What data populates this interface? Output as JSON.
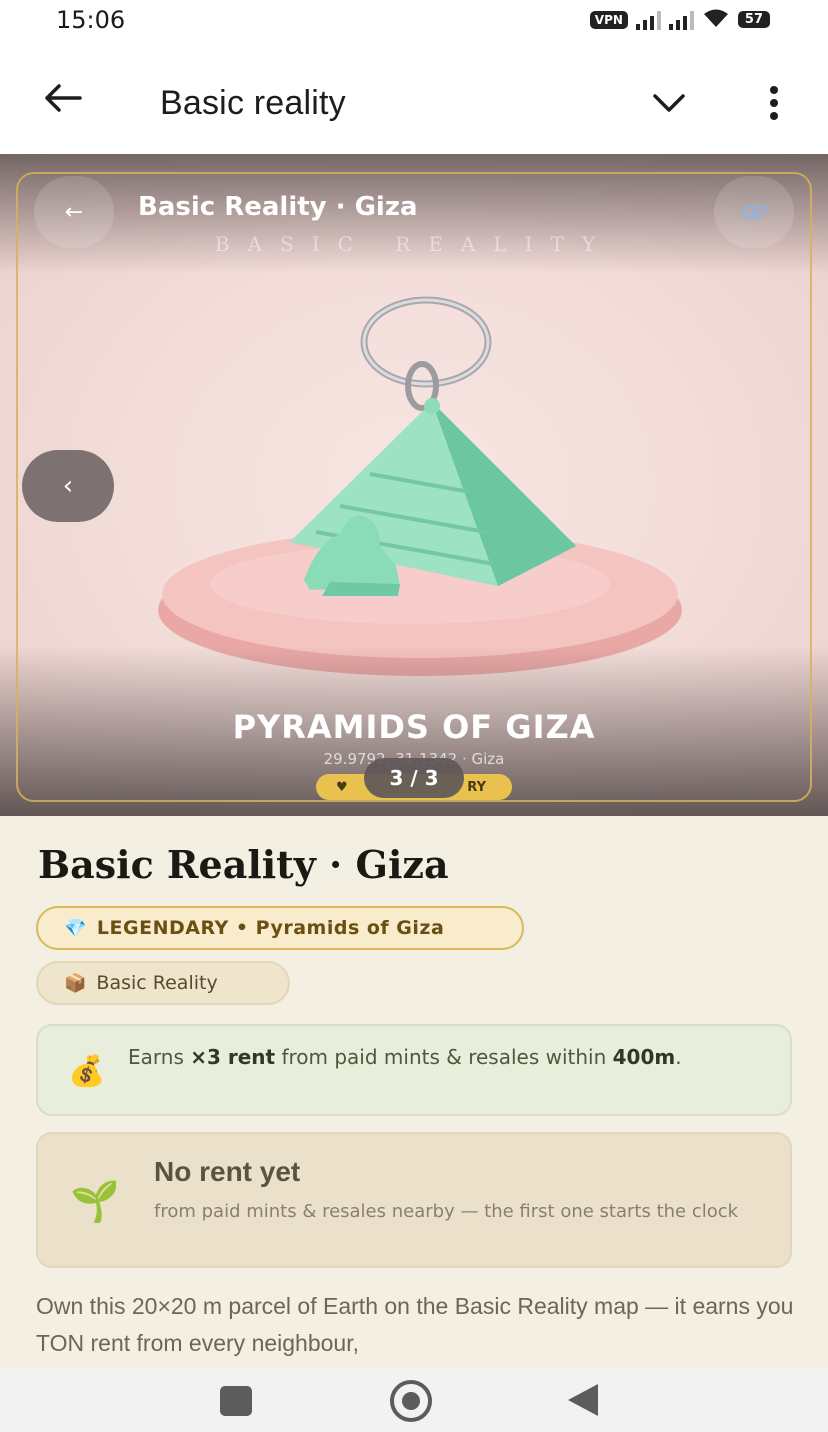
{
  "status_bar": {
    "time": "15:06",
    "vpn": "VPN",
    "battery": "57"
  },
  "app_bar": {
    "title": "Basic reality",
    "icons": [
      "arrow-left-icon",
      "chevron-down-icon",
      "more-vert-icon"
    ]
  },
  "hero": {
    "back_glyph": "←",
    "title": "Basic Reality · Giza",
    "watermark": "BASIC REALITY",
    "prev_glyph": "‹",
    "name": "PYRAMIDS OF GIZA",
    "coords": "29.9792, 31.1342 · Giza",
    "rarity_badge_left": "♥",
    "rarity_badge_right": "RY",
    "counter": "3 / 3",
    "accent_color": "#d6b25a"
  },
  "content": {
    "title": "Basic Reality · Giza",
    "rarity_chip": {
      "icon": "💎",
      "label": "LEGENDARY • Pyramids of Giza"
    },
    "collection_chip": {
      "icon": "📦",
      "label": "Basic Reality"
    },
    "earn_card": {
      "icon": "💰",
      "prefix": "Earns ",
      "multiplier": "×3 rent",
      "middle": " from paid mints & resales within ",
      "radius": "400m",
      "suffix": "."
    },
    "no_rent_card": {
      "icon": "🌱",
      "title": "No rent yet",
      "subtitle": "from paid mints & resales nearby — the first one starts the clock"
    },
    "description": "Own this 20×20 m parcel of Earth on the Basic Reality map — it earns you TON rent from every neighbour,"
  },
  "nav_bar": {
    "icons": [
      "recents-icon",
      "home-icon",
      "back-icon"
    ]
  }
}
